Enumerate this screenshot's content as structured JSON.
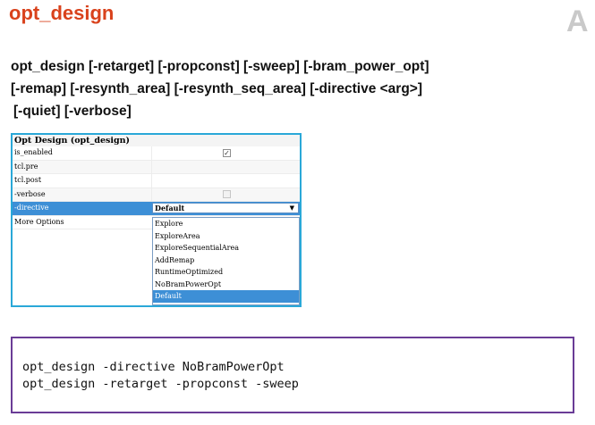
{
  "slide": {
    "title": "opt_design",
    "logo_text": "A",
    "syntax_lines": [
      "opt_design [-retarget] [-propconst] [-sweep] [-bram_power_opt]",
      "[-remap] [-resynth_area] [-resynth_seq_area] [-directive <arg>]",
      "[-quiet] [-verbose]"
    ],
    "colors": {
      "title": "#d9421c",
      "dialog_border": "#2aa8d8",
      "cmd_border": "#6a3c96",
      "selection": "#3d8fd6"
    }
  },
  "dialog": {
    "header": "Opt Design (opt_design)",
    "rows": [
      {
        "name": "is_enabled",
        "type": "checkbox",
        "checked": true
      },
      {
        "name": "tcl.pre",
        "type": "text"
      },
      {
        "name": "tcl.post",
        "type": "text"
      },
      {
        "name": "-verbose",
        "type": "checkbox",
        "checked": false
      },
      {
        "name": "-directive",
        "type": "select",
        "value": "Default"
      },
      {
        "name": "More Options",
        "type": "text"
      }
    ],
    "directive_options": [
      "Explore",
      "ExploreArea",
      "ExploreSequentialArea",
      "AddRemap",
      "RuntimeOptimized",
      "NoBramPowerOpt",
      "Default"
    ],
    "selected_option": "Default"
  },
  "commands": [
    "opt_design -directive NoBramPowerOpt",
    "opt_design -retarget -propconst -sweep"
  ]
}
